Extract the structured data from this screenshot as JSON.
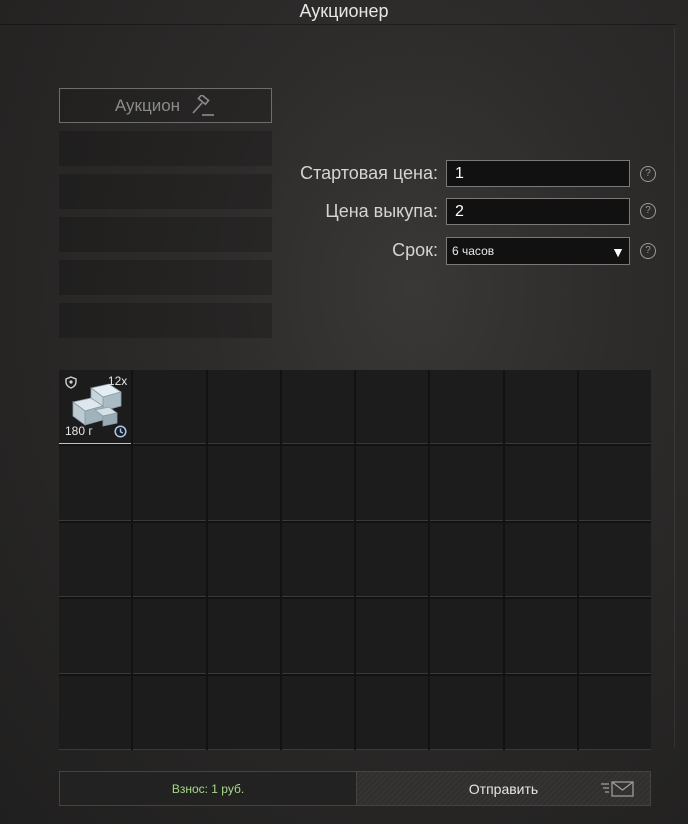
{
  "window": {
    "title": "Аукционер"
  },
  "tabs": {
    "active_label": "Аукцион",
    "empty_count": 5
  },
  "form": {
    "start_price_label": "Стартовая цена:",
    "start_price_value": "1",
    "buyout_price_label": "Цена выкупа:",
    "buyout_price_value": "2",
    "duration_label": "Срок:",
    "duration_value": "6 часов",
    "help_glyph": "?"
  },
  "inventory": {
    "columns": 8,
    "rows": 5,
    "item": {
      "name_icon": "stone-blocks-icon",
      "quantity": "12x",
      "weight": "180 г"
    }
  },
  "footer": {
    "fee_text": "Взнос: 1 руб.",
    "send_label": "Отправить"
  },
  "colors": {
    "fee_text": "#a5d98a",
    "field_bg": "#111111"
  }
}
